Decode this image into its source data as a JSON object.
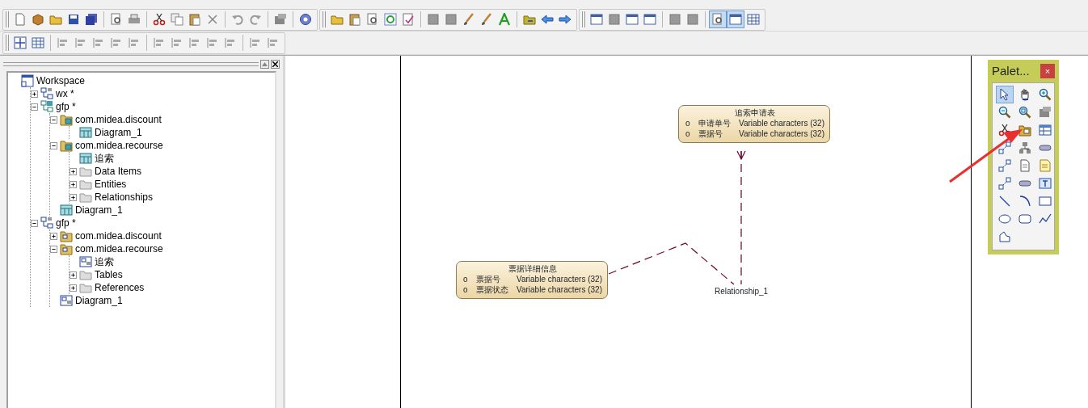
{
  "toolbar_rows": [
    {
      "toolbars": [
        {
          "groups": [
            [
              {
                "kind": "doc",
                "pressed": false
              },
              {
                "kind": "box",
                "pressed": false
              },
              {
                "kind": "folder",
                "pressed": false
              },
              {
                "kind": "disk",
                "pressed": false
              },
              {
                "kind": "disks",
                "pressed": false
              }
            ],
            [
              {
                "kind": "preview",
                "pressed": false
              },
              {
                "kind": "print",
                "pressed": false
              }
            ],
            [
              {
                "kind": "scissors",
                "pressed": false
              },
              {
                "kind": "copy",
                "pressed": false
              },
              {
                "kind": "paste",
                "pressed": false
              },
              {
                "kind": "cross",
                "pressed": false
              }
            ],
            [
              {
                "kind": "undo",
                "pressed": false
              },
              {
                "kind": "redo",
                "pressed": false
              }
            ],
            [
              {
                "kind": "prop",
                "pressed": false
              }
            ],
            [
              {
                "kind": "help",
                "pressed": false
              }
            ]
          ]
        },
        {
          "groups": [
            [
              {
                "kind": "folder",
                "pressed": false
              },
              {
                "kind": "paste",
                "pressed": false
              },
              {
                "kind": "preview",
                "pressed": false
              },
              {
                "kind": "refresh",
                "pressed": false
              },
              {
                "kind": "check",
                "pressed": false
              }
            ],
            [
              {
                "kind": "blank",
                "pressed": false
              },
              {
                "kind": "blank",
                "pressed": false
              },
              {
                "kind": "brush",
                "pressed": false
              },
              {
                "kind": "brush",
                "pressed": false
              },
              {
                "kind": "font",
                "pressed": false
              }
            ],
            [
              {
                "kind": "export",
                "pressed": false
              },
              {
                "kind": "arrowl",
                "pressed": false
              },
              {
                "kind": "arrowr",
                "pressed": false
              }
            ]
          ]
        },
        {
          "groups": [
            [
              {
                "kind": "win",
                "pressed": false
              },
              {
                "kind": "blank",
                "pressed": false
              },
              {
                "kind": "win",
                "pressed": false
              },
              {
                "kind": "win",
                "pressed": false
              }
            ],
            [
              {
                "kind": "blank",
                "pressed": false
              },
              {
                "kind": "blank",
                "pressed": false
              }
            ],
            [
              {
                "kind": "preview",
                "pressed": true
              },
              {
                "kind": "win",
                "pressed": true
              },
              {
                "kind": "grid",
                "pressed": false
              }
            ]
          ]
        }
      ]
    },
    {
      "toolbars": [
        {
          "groups": [
            [
              {
                "kind": "target",
                "pressed": false
              },
              {
                "kind": "grid",
                "pressed": false
              }
            ],
            [
              {
                "kind": "align",
                "pressed": false
              },
              {
                "kind": "align",
                "pressed": false
              },
              {
                "kind": "align",
                "pressed": false
              },
              {
                "kind": "align",
                "pressed": false
              },
              {
                "kind": "align",
                "pressed": false
              }
            ],
            [
              {
                "kind": "align",
                "pressed": false
              },
              {
                "kind": "align",
                "pressed": false
              },
              {
                "kind": "align",
                "pressed": false
              },
              {
                "kind": "align",
                "pressed": false
              },
              {
                "kind": "align",
                "pressed": false
              }
            ],
            [
              {
                "kind": "align",
                "pressed": false
              },
              {
                "kind": "align",
                "pressed": false
              }
            ]
          ]
        }
      ]
    }
  ],
  "browser": {
    "tree": [
      {
        "label": "Workspace",
        "kind": "workspace",
        "children": [
          {
            "label": "wx *",
            "kind": "pdm",
            "expanded": false
          },
          {
            "label": "gfp *",
            "kind": "cdm",
            "expanded": true,
            "children": [
              {
                "label": "com.midea.discount",
                "kind": "cdmpkg",
                "expanded": true,
                "children": [
                  {
                    "label": "Diagram_1",
                    "kind": "cdmdiag"
                  }
                ]
              },
              {
                "label": "com.midea.recourse",
                "kind": "cdmpkg",
                "expanded": true,
                "children": [
                  {
                    "label": "追索",
                    "kind": "cdmdiag"
                  },
                  {
                    "label": "Data Items",
                    "kind": "folder",
                    "expanded": false
                  },
                  {
                    "label": "Entities",
                    "kind": "folder",
                    "expanded": false
                  },
                  {
                    "label": "Relationships",
                    "kind": "folder",
                    "expanded": false
                  }
                ]
              },
              {
                "label": "Diagram_1",
                "kind": "cdmdiag"
              }
            ]
          },
          {
            "label": "gfp *",
            "kind": "pdm",
            "expanded": true,
            "children": [
              {
                "label": "com.midea.discount",
                "kind": "pdmpkg",
                "expanded": false
              },
              {
                "label": "com.midea.recourse",
                "kind": "pdmpkg",
                "expanded": true,
                "children": [
                  {
                    "label": "追索",
                    "kind": "pdmdiag"
                  },
                  {
                    "label": "Tables",
                    "kind": "folder",
                    "expanded": false
                  },
                  {
                    "label": "References",
                    "kind": "folder",
                    "expanded": false
                  }
                ]
              },
              {
                "label": "Diagram_1",
                "kind": "pdmdiag"
              }
            ]
          }
        ]
      }
    ]
  },
  "diagram": {
    "entities": [
      {
        "title": "追索申请表",
        "attributes": [
          {
            "marker": "o",
            "name": "申请单号",
            "type": "Variable characters (32)"
          },
          {
            "marker": "o",
            "name": "票据号",
            "type": "Variable characters (32)"
          }
        ]
      },
      {
        "title": "票据详细信息",
        "attributes": [
          {
            "marker": "o",
            "name": "票据号",
            "type": "Variable characters (32)"
          },
          {
            "marker": "o",
            "name": "票据状态",
            "type": "Variable characters (32)"
          }
        ]
      }
    ],
    "relationship": {
      "label": "Relationship_1"
    }
  },
  "palette": {
    "title": "Palet...",
    "close": "×",
    "tools": [
      {
        "kind": "pointer",
        "selected": true
      },
      {
        "kind": "hand",
        "selected": false
      },
      {
        "kind": "zoomin",
        "selected": false
      },
      {
        "kind": "zoomout",
        "selected": false
      },
      {
        "kind": "zoomfit",
        "selected": false
      },
      {
        "kind": "prop",
        "selected": false
      },
      {
        "kind": "scissors",
        "selected": false
      },
      {
        "kind": "package",
        "selected": false
      },
      {
        "kind": "entity",
        "selected": false
      },
      {
        "kind": "link",
        "selected": false
      },
      {
        "kind": "inherit",
        "selected": false
      },
      {
        "kind": "assoc",
        "selected": false
      },
      {
        "kind": "link",
        "selected": false
      },
      {
        "kind": "file",
        "selected": false
      },
      {
        "kind": "note",
        "selected": false
      },
      {
        "kind": "link",
        "selected": false
      },
      {
        "kind": "assoc",
        "selected": false
      },
      {
        "kind": "textbox",
        "selected": false
      },
      {
        "kind": "line",
        "selected": false
      },
      {
        "kind": "arc",
        "selected": false
      },
      {
        "kind": "rect",
        "selected": false
      },
      {
        "kind": "ellipse",
        "selected": false
      },
      {
        "kind": "rrect",
        "selected": false
      },
      {
        "kind": "polyline",
        "selected": false
      },
      {
        "kind": "polygon",
        "selected": false
      }
    ]
  }
}
